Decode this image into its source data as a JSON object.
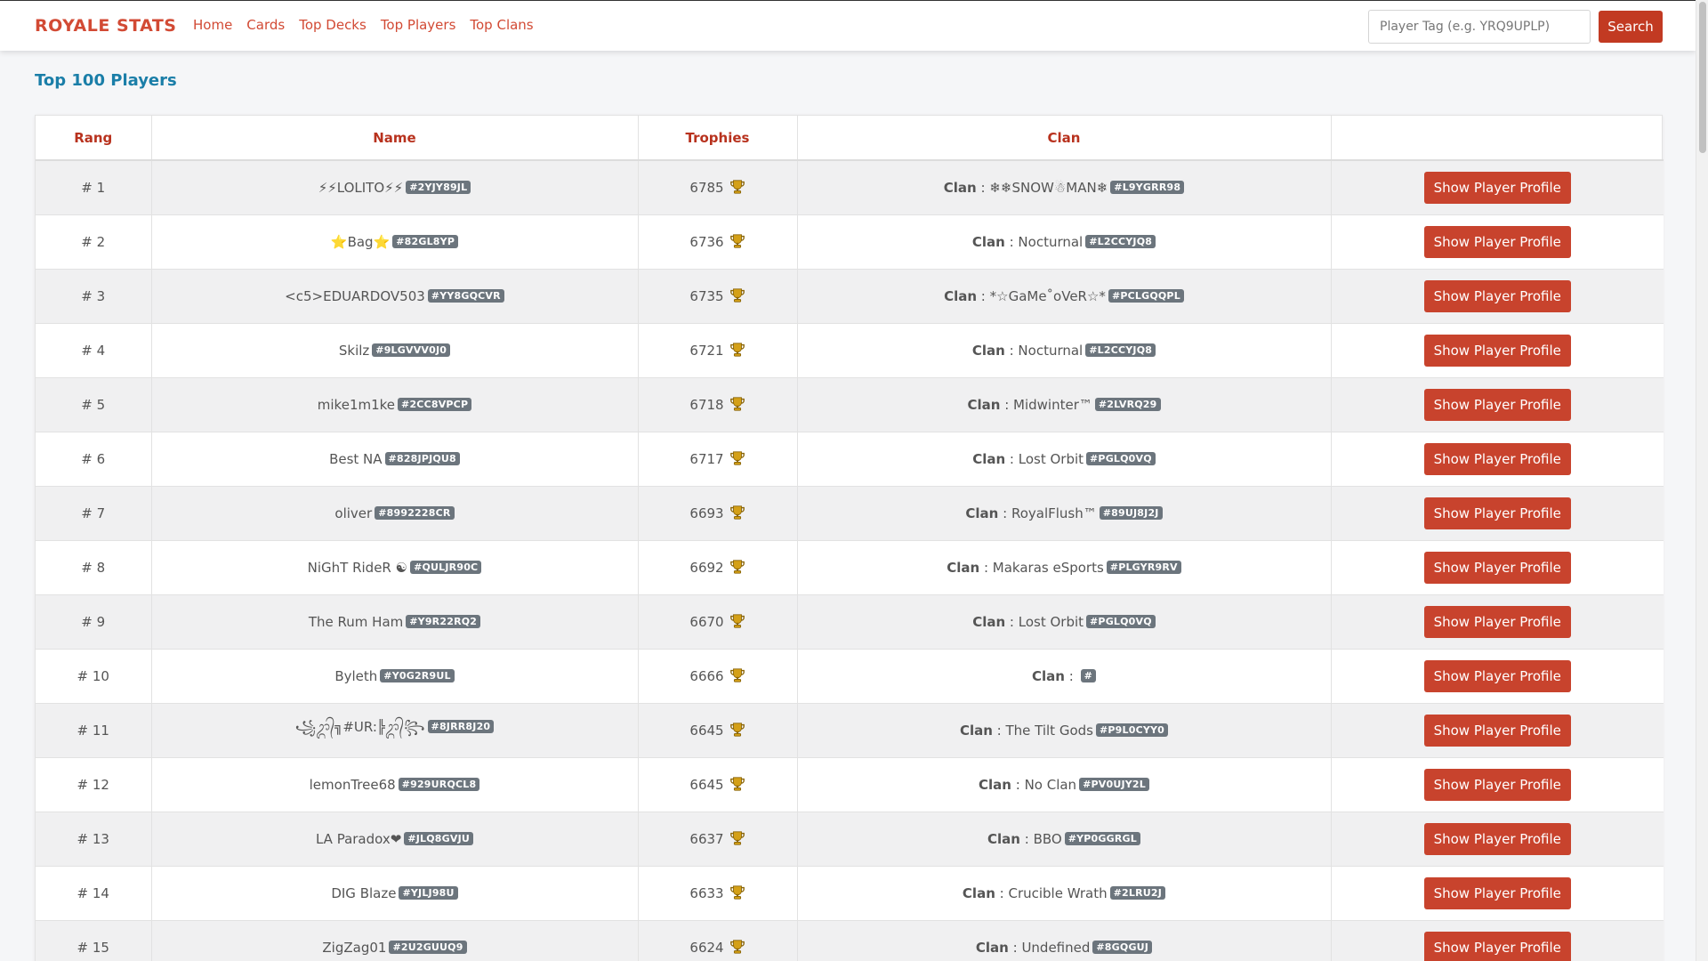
{
  "brand": "ROYALE STATS",
  "nav": [
    "Home",
    "Cards",
    "Top Decks",
    "Top Players",
    "Top Clans"
  ],
  "search": {
    "placeholder": "Player Tag (e.g. YRQ9UPLP)",
    "button": "Search"
  },
  "page_title": "Top 100 Players",
  "columns": [
    "Rang",
    "Name",
    "Trophies",
    "Clan",
    ""
  ],
  "clan_prefix": "Clan",
  "profile_button": "Show Player Profile",
  "colors": {
    "accent": "#c8432d",
    "title": "#1a7ea8",
    "tag_bg": "#6c757d"
  },
  "players": [
    {
      "rank": "# 1",
      "name": "⚡⚡LOLITO⚡⚡",
      "tag": "#2YJY89JL",
      "trophies": "6785",
      "clan": "❄❄SNOW☃MAN❄",
      "clan_tag": "#L9YGRR98"
    },
    {
      "rank": "# 2",
      "name": "⭐Bag⭐",
      "tag": "#82GL8YP",
      "trophies": "6736",
      "clan": "Nocturnal",
      "clan_tag": "#L2CCYJQ8"
    },
    {
      "rank": "# 3",
      "name": "<c5>EDUARDOV503",
      "tag": "#YY8GQCVR",
      "trophies": "6735",
      "clan": "*☆GaMe˚oVeR☆*",
      "clan_tag": "#PCLGQQPL"
    },
    {
      "rank": "# 4",
      "name": "Skilz",
      "tag": "#9LGVVV0J0",
      "trophies": "6721",
      "clan": "Nocturnal",
      "clan_tag": "#L2CCYJQ8"
    },
    {
      "rank": "# 5",
      "name": "mike1m1ke",
      "tag": "#2CC8VPCP",
      "trophies": "6718",
      "clan": "Midwinter™",
      "clan_tag": "#2LVRQ29"
    },
    {
      "rank": "# 6",
      "name": "Best NA",
      "tag": "#828JPJQU8",
      "trophies": "6717",
      "clan": "Lost Orbit",
      "clan_tag": "#PGLQ0VQ"
    },
    {
      "rank": "# 7",
      "name": "oliver",
      "tag": "#8992228CR",
      "trophies": "6693",
      "clan": "RoyalFlush™",
      "clan_tag": "#89UJ8J2J"
    },
    {
      "rank": "# 8",
      "name": "NiGhT RideR ☯",
      "tag": "#QULJR90C",
      "trophies": "6692",
      "clan": "Makaras eSports",
      "clan_tag": "#PLGYR9RV"
    },
    {
      "rank": "# 9",
      "name": "The Rum Ham",
      "tag": "#Y9R22RQ2",
      "trophies": "6670",
      "clan": "Lost Orbit",
      "clan_tag": "#PGLQ0VQ"
    },
    {
      "rank": "# 10",
      "name": "Byleth",
      "tag": "#Y0G2R9UL",
      "trophies": "6666",
      "clan": "",
      "clan_tag": "#"
    },
    {
      "rank": "# 11",
      "name": "꧁ᬊ᭄╗#UR:╠ᬊ᭄꧂",
      "tag": "#8JRR8J20",
      "trophies": "6645",
      "clan": "The Tilt Gods",
      "clan_tag": "#P9L0CYY0"
    },
    {
      "rank": "# 12",
      "name": "lemonTree68",
      "tag": "#929URQCL8",
      "trophies": "6645",
      "clan": "No Clan",
      "clan_tag": "#PV0UJY2L"
    },
    {
      "rank": "# 13",
      "name": "LA Paradox❤",
      "tag": "#JLQ8GVJU",
      "trophies": "6637",
      "clan": "BBO",
      "clan_tag": "#YP0GGRGL"
    },
    {
      "rank": "# 14",
      "name": "DIG Blaze",
      "tag": "#YJLJ98U",
      "trophies": "6633",
      "clan": "Crucible Wrath",
      "clan_tag": "#2LRU2J"
    },
    {
      "rank": "# 15",
      "name": "ZigZag01",
      "tag": "#2U2GUUQ9",
      "trophies": "6624",
      "clan": "Undefined",
      "clan_tag": "#8GQGUJ"
    }
  ]
}
